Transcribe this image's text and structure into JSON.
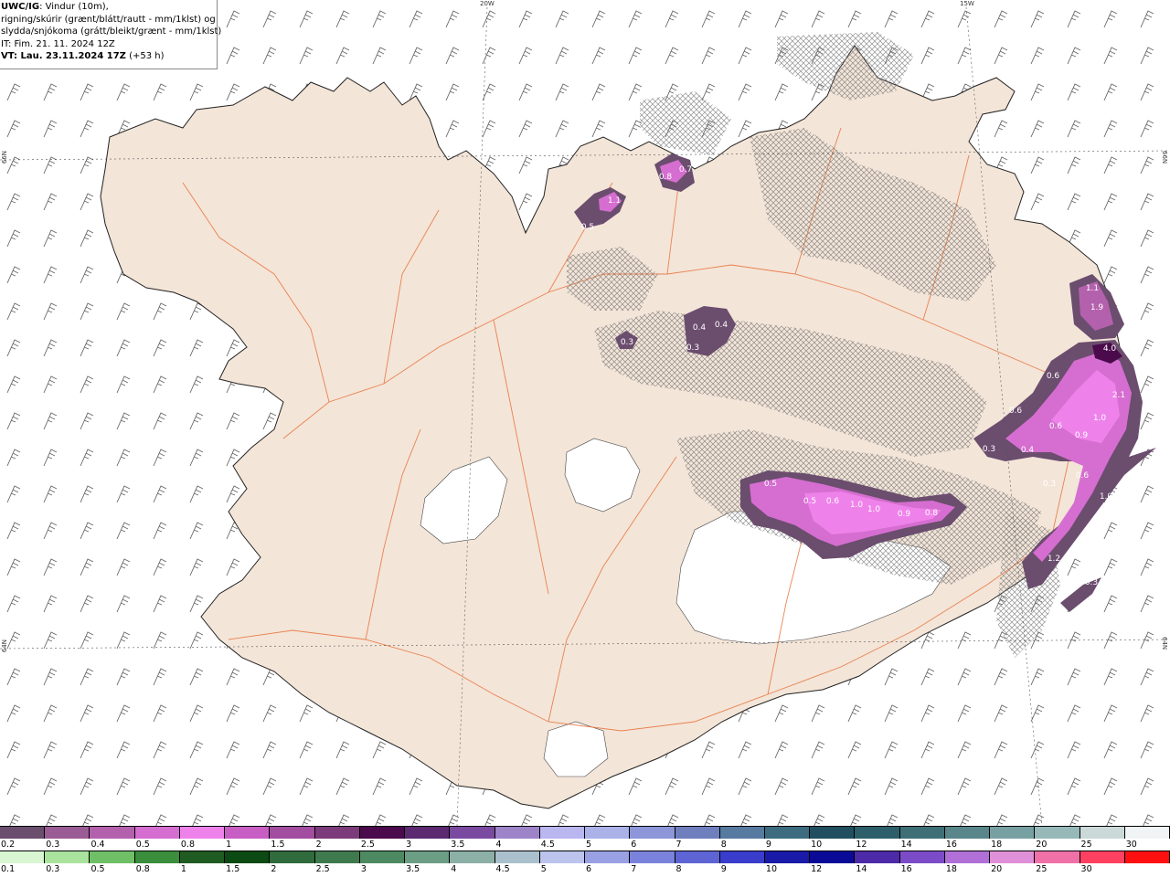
{
  "info": {
    "model": "UWC/IG",
    "line1_rest": ": Vindur (10m),",
    "line2": "rigning/skúrir (grænt/blátt/rautt - mm/1klst) og",
    "line3": "slydda/snjókoma (grátt/bleikt/grænt - mm/1klst)",
    "line4": "IT: Fim. 21. 11. 2024 12Z",
    "vt_bold": "VT: Lau. 23.11.2024 17Z",
    "vt_rest": " (+53 h)"
  },
  "coords": {
    "top_20w": "20W",
    "top_15w": "15W",
    "left_66n": "66N",
    "left_64n": "64N",
    "right_66n": "66N",
    "right_64n": "64N"
  },
  "precip_labels": [
    {
      "text": "0.5"
    },
    {
      "text": "1.1"
    },
    {
      "text": "0.8"
    },
    {
      "text": "0.7"
    },
    {
      "text": "0.4"
    },
    {
      "text": "0.4"
    },
    {
      "text": "0.3"
    },
    {
      "text": "0.3"
    },
    {
      "text": "1.1"
    },
    {
      "text": "1.9"
    },
    {
      "text": "4.0"
    },
    {
      "text": "0.6"
    },
    {
      "text": "2.1"
    },
    {
      "text": "0.6"
    },
    {
      "text": "1.0"
    },
    {
      "text": "0.6"
    },
    {
      "text": "0.9"
    },
    {
      "text": "0.3"
    },
    {
      "text": "0.4"
    },
    {
      "text": "0.3"
    },
    {
      "text": "0.6"
    },
    {
      "text": "1.0"
    },
    {
      "text": "1.2"
    },
    {
      "text": "0.3"
    },
    {
      "text": "0.5"
    },
    {
      "text": "0.5"
    },
    {
      "text": "0.6"
    },
    {
      "text": "1.0"
    },
    {
      "text": "1.0"
    },
    {
      "text": "0.9"
    },
    {
      "text": "0.8"
    }
  ],
  "legend_snow": {
    "labels": [
      "0.2",
      "0.3",
      "0.4",
      "0.5",
      "0.8",
      "1",
      "1.5",
      "2",
      "2.5",
      "3",
      "3.5",
      "4",
      "4.5",
      "5",
      "6",
      "7",
      "8",
      "9",
      "10",
      "12",
      "14",
      "16",
      "18",
      "20",
      "25",
      "30"
    ],
    "colors": [
      "#6b4d6e",
      "#9b5c96",
      "#b461ad",
      "#d56ed0",
      "#ef82ea",
      "#c85ec4",
      "#a24da0",
      "#7c3b7b",
      "#4a0a4c",
      "#5b2a70",
      "#7a49a0",
      "#9d84c8",
      "#b9b6f0",
      "#aab2e8",
      "#8c96d8",
      "#6f7fbe",
      "#577aa0",
      "#3d6c80",
      "#214f60",
      "#2d5f6a",
      "#3f6f76",
      "#58868a",
      "#77a0a2",
      "#96b9b8",
      "#cbd9d8",
      "#f0f4f4"
    ]
  },
  "legend_rain": {
    "labels": [
      "0.1",
      "0.3",
      "0.5",
      "0.8",
      "1",
      "1.5",
      "2",
      "2.5",
      "3",
      "3.5",
      "4",
      "4.5",
      "5",
      "6",
      "7",
      "8",
      "9",
      "10",
      "12",
      "14",
      "16",
      "18",
      "20",
      "25",
      "30"
    ],
    "colors": [
      "#d9f5d2",
      "#a9e39e",
      "#6fbf67",
      "#3a8e3c",
      "#205c22",
      "#0b4a12",
      "#2f6b3c",
      "#3f7a4e",
      "#4d8a62",
      "#6b9e84",
      "#8cb0a6",
      "#aac0cc",
      "#bcc4ee",
      "#9aa0e4",
      "#7b82dc",
      "#5e64d4",
      "#3a3ccc",
      "#1a1aa8",
      "#0a0a96",
      "#4c2aa8",
      "#7c4cc8",
      "#b070d8",
      "#e090d8",
      "#f070a8",
      "#ff4060",
      "#ff1010"
    ]
  }
}
